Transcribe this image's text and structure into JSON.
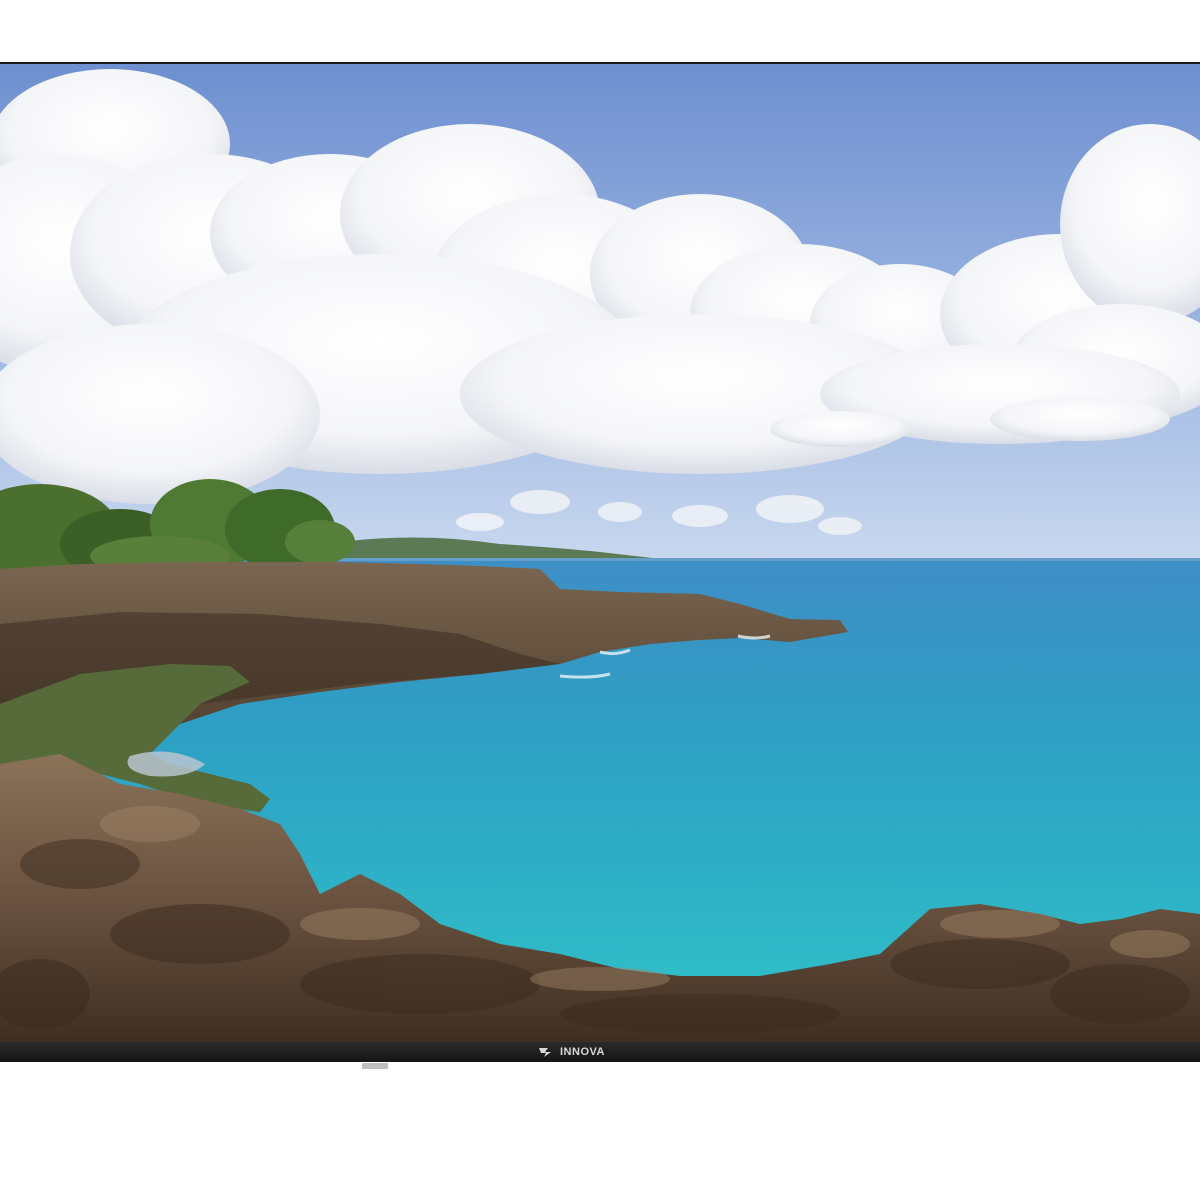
{
  "tv": {
    "brand": "INNOVA",
    "screen_content": "coastal-landscape"
  },
  "colors": {
    "bezel": "#1b1b1b",
    "sky": "#8aa3d6",
    "sea": "#2fb0c4",
    "rock": "#6b5540",
    "foliage": "#3d6b2b"
  }
}
